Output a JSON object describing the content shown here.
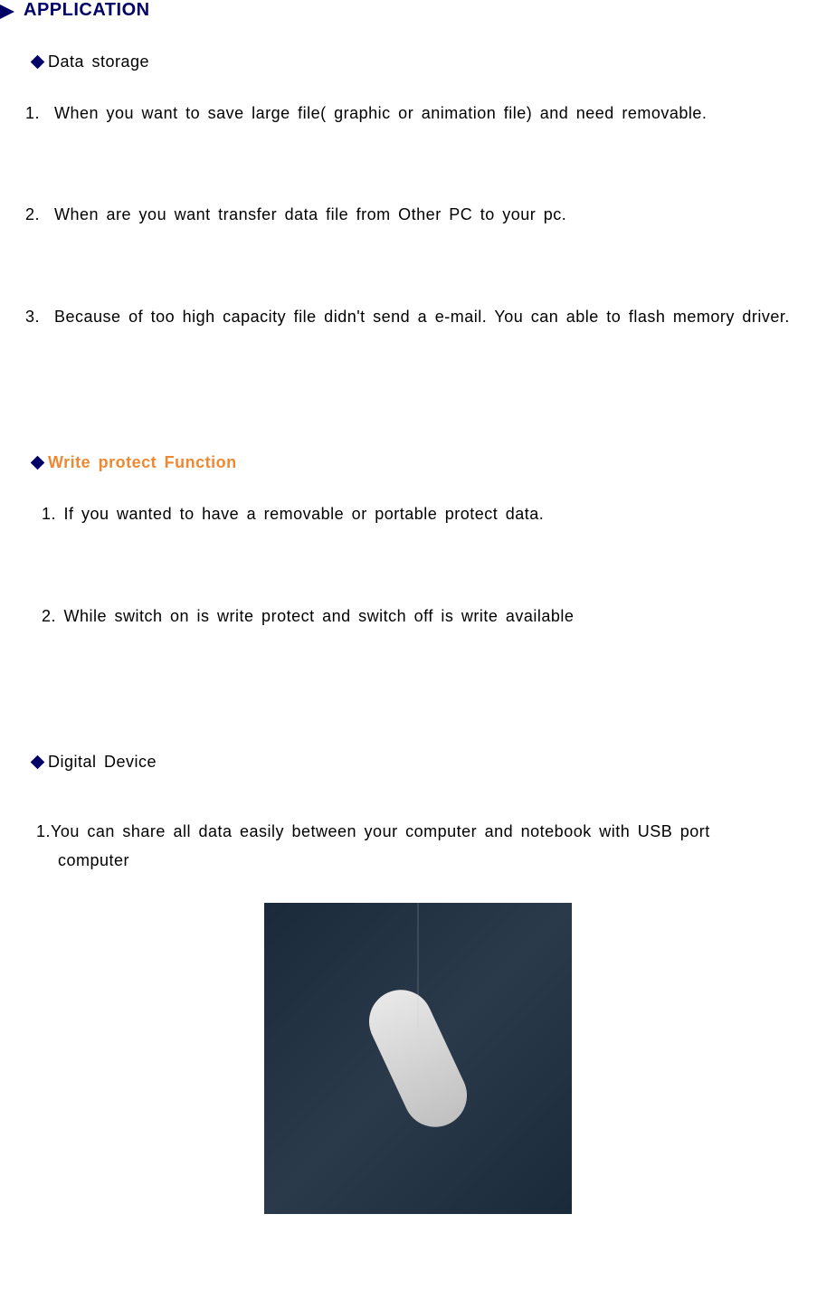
{
  "header": {
    "title": "APPLICATION"
  },
  "sections": {
    "data_storage": {
      "label": "Data storage",
      "items": {
        "1": {
          "num": "1.",
          "text": "When  you  want  to  save  large  file(  graphic  or  animation file)  and  need  removable."
        },
        "2": {
          "num": "2.",
          "text": "When are  you  want  transfer  data  file  from  Other  PC  to  your  pc."
        },
        "3": {
          "num": "3.",
          "text": "Because  of  too  high  capacity  file  didn't  send  a  e-mail.  You  can  able  to  flash memory  driver."
        }
      }
    },
    "write_protect": {
      "label": "Write  protect  Function",
      "items": {
        "1": "1.  If  you  wanted  to  have  a  removable  or  portable  protect  data.",
        "2": "2.  While  switch  on  is  write  protect  and switch  off  is  write  available"
      }
    },
    "digital_device": {
      "label": "Digital  Device",
      "items": {
        "1": {
          "num": "1.",
          "text_line1": "You  can  share  all  data easily  between  your  computer  and  notebook  with  USB  port",
          "text_line2": "computer"
        }
      }
    }
  }
}
